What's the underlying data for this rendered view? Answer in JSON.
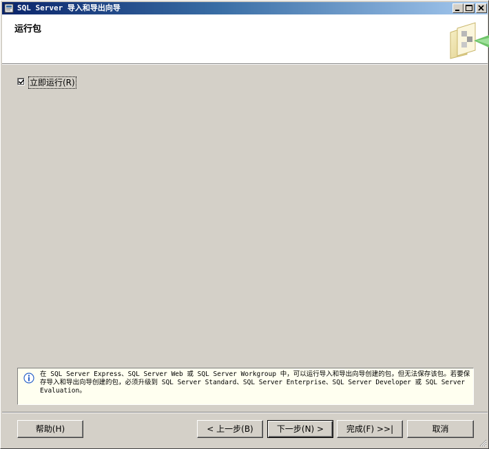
{
  "window": {
    "title": "SQL Server 导入和导出向导",
    "minimize_label": "_",
    "maximize_label": "□",
    "close_label": "×"
  },
  "header": {
    "page_title": "运行包"
  },
  "options": {
    "run_immediately": {
      "label": "立即运行(R)",
      "checked": true
    }
  },
  "info": {
    "icon": "info-icon",
    "text": "在 SQL Server Express、SQL Server Web 或 SQL Server Workgroup 中，可以运行导入和导出向导创建的包，但无法保存该包。若要保存导入和导出向导创建的包，必须升级到 SQL Server Standard、SQL Server Enterprise、SQL Server Developer 或 SQL Server Evaluation。"
  },
  "buttons": {
    "help": "帮助(H)",
    "back": "< 上一步(B)",
    "next": "下一步(N) >",
    "finish": "完成(F) >>|",
    "cancel": "取消"
  },
  "colors": {
    "titlebar_start": "#0a246a",
    "titlebar_end": "#a6caf0",
    "face": "#d4d0c8",
    "info_background": "#fffff0"
  }
}
